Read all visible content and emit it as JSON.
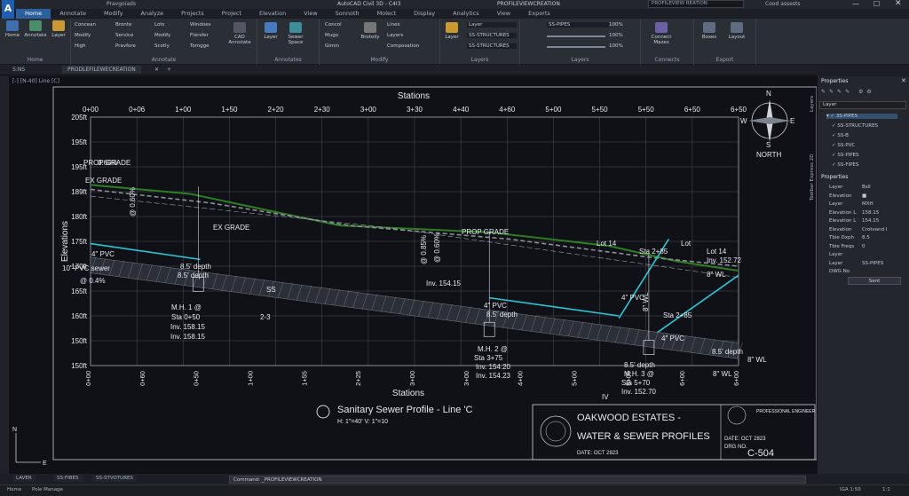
{
  "app": {
    "quick_access": "Pravgoiads",
    "title": "AutoCAD Civil 3D - C4I3",
    "title_sub": "PROFILEVIEWCREATION",
    "search_placeholder": "PROFILEVIEW REATION",
    "user": "Cood assests"
  },
  "ribbon_tabs": [
    "Home",
    "Annotate",
    "Modify",
    "Analyze",
    "Projects",
    "Project",
    "Elevation",
    "View",
    "Sonnoth",
    "Molect",
    "Display",
    "Analytics",
    "View",
    "Exports"
  ],
  "ribbon": {
    "home_btn": "Home",
    "annotate_btn": "Annotate",
    "layer_btn": "Layer",
    "panel_home": "Home",
    "group1": [
      "Concean",
      "Modify",
      "High"
    ],
    "group2": [
      "Bronte",
      "Service",
      "Pravfore"
    ],
    "group3": [
      "Lots",
      "Modify",
      "Scotly"
    ],
    "group4": [
      "Windoes",
      "Flersfer",
      "Tomgge"
    ],
    "cad_annotate": "CAD Annotate",
    "panel_annotate": "Annotate",
    "layer2": "Layer",
    "sewer_space": "Sewer Space",
    "group5": [
      "Concol",
      "Mugo",
      "Gimin"
    ],
    "brotoily": "Brotoily",
    "group6": [
      "Lines",
      "Layers",
      "Composation"
    ],
    "panel_annotates": "Annotates",
    "panel_modify": "Modify",
    "layer3": "Layer",
    "layer_rows": [
      "SS-STRUCTURES",
      "SS-STRUCTURES"
    ],
    "layer_sel": "Layer",
    "panel_layers": "Layers",
    "pipes_row": "SS-PIPES",
    "vals": [
      "100%",
      "100%",
      "100%"
    ],
    "panel_layers2": "Layers",
    "connect": "Connect Mazes",
    "panel_connects": "Connects",
    "boxes": "Boxes",
    "layout": "Layout",
    "panel_export": "Export"
  },
  "doc_tabs": [
    "S:NS",
    "PRODLEFILEWECREATION"
  ],
  "view_label": "[-] [N-40] Line [C]",
  "chart_data": {
    "type": "line",
    "title": "Sanitary Sewer Profile - Line 'C",
    "subtitle": "H: 1\"=40'  V: 1\"=10",
    "x_title_top": "Stations",
    "x_title_bottom": "Stations",
    "ylabel": "Elevations",
    "x_top_ticks": [
      "0+00",
      "0+06",
      "1+00",
      "1+50",
      "2+20",
      "2+30",
      "3+00",
      "3+30",
      "4+40",
      "4+60",
      "5+00",
      "5+50",
      "5+50",
      "6+50",
      "6+50"
    ],
    "x_bottom_ticks": [
      "0+00",
      "0+60",
      "0+50",
      "1+00",
      "1+55",
      "2+25",
      "3+00",
      "3+00",
      "4+00",
      "5+00",
      "5+00",
      "6+00",
      "6+00"
    ],
    "y_ticks": [
      "205ft",
      "195ft",
      "195ft",
      "189ft",
      "180ft",
      "175ft",
      "170ft",
      "165ft",
      "160ft",
      "150ft",
      "150ft"
    ],
    "xlim": [
      0,
      650
    ],
    "ylim": [
      150,
      205
    ],
    "grid": true,
    "series": [
      {
        "name": "PROP GRADE",
        "color": "#2d7d22",
        "x": [
          0,
          100,
          250,
          400,
          520,
          590,
          650
        ],
        "y": [
          190,
          188,
          181,
          179.5,
          176.5,
          173,
          171
        ]
      },
      {
        "name": "EX GRADE",
        "color": "#8a8f97",
        "x": [
          0,
          120,
          260,
          420,
          560,
          650
        ],
        "y": [
          189,
          186,
          181,
          178,
          174,
          172
        ]
      },
      {
        "name": "",
        "color": "#2233ff",
        "x": [
          0,
          650
        ],
        "y": [
          172,
          153
        ]
      },
      {
        "name": "",
        "color": "#25c7d8",
        "x": [
          0,
          110
        ],
        "y": [
          177,
          173.5
        ]
      },
      {
        "name": "",
        "color": "#25c7d8",
        "x": [
          400,
          530
        ],
        "y": [
          165,
          161
        ]
      },
      {
        "name": "",
        "color": "#25c7d8",
        "x": [
          530,
          560,
          650
        ],
        "y": [
          158,
          156,
          170
        ]
      },
      {
        "name": "",
        "color": "#25c7d8",
        "x": [
          530,
          580
        ],
        "y": [
          160.5,
          178
        ]
      }
    ],
    "annotations": [
      "PROP GRADE",
      "EX GRADE",
      "EX GRADE",
      "PROP GRADE",
      "4\" PVC",
      "10\" PVC sewer",
      "@ 0.4%",
      "8.5' depth",
      "8.5' depth",
      "SS",
      "2-3",
      "M.H. 1 @",
      "Sta 0+50",
      "Inv. 158.15",
      "Inv. 158.15",
      "@ 0.60%",
      "@ 0.60%",
      "@ 0.85%",
      "Inv. 154.15",
      "4\" PVC",
      "8.5' depth",
      "M.H. 2 @",
      "Sta 3+75",
      "Inv. 154.20",
      "Inv. 154.23",
      "4\" PVC",
      "Lot 14",
      "Sta 2+85",
      "Lot",
      "Lot 14",
      "Sta 2+85",
      "4\" PVC",
      "8.5' depth",
      "M.H. 3 @",
      "Sta 5+70",
      "Inv. 152.70",
      "Inv. 152.72",
      "8\" WL",
      "8.5' depth",
      "8\" WL",
      "8\" WL",
      "IV",
      "8\" WL",
      "0.60%"
    ]
  },
  "compass": {
    "n": "N",
    "s": "S",
    "e": "E",
    "w": "W",
    "label": "NORTH"
  },
  "ucs": {
    "n": "N",
    "e": "E"
  },
  "titleblock": {
    "line1": "OAKWOOD ESTATES -",
    "line2": "WATER & SEWER PROFILES",
    "date_left": "DATE: OCT 2823",
    "stamp_text": "PROFESSIONAL ENGINEER STATE OF",
    "date_right": "DATE: OCT 2823",
    "dwg_no_label": "DRG NO.",
    "sheet": "C-504"
  },
  "properties": {
    "title": "Properties",
    "layer_dropdown": "Layer",
    "tree": [
      "3S-PIPES",
      "SS-STRUCTURES",
      "SS-B",
      "SS-PVC",
      "SS-PIPES",
      "SS-FIPES"
    ],
    "section": "Properties",
    "rows": [
      {
        "k": "Layer",
        "v": "Bsll"
      },
      {
        "k": "Elevation",
        "v": "■"
      },
      {
        "k": "Layer",
        "v": "MXH"
      },
      {
        "k": "Elevation L",
        "v": "158.15"
      },
      {
        "k": "Elevation L",
        "v": "154.15"
      },
      {
        "k": "Elevation",
        "v": "Crotvand I"
      },
      {
        "k": "Tbie Dxph",
        "v": "8.5"
      },
      {
        "k": "Tbie Freqs",
        "v": "0"
      },
      {
        "k": "Layer",
        "v": ""
      },
      {
        "k": "Layer",
        "v": "SS-PIPES"
      },
      {
        "k": "DWG No",
        "v": ""
      }
    ],
    "sent_btn": "Sent",
    "side_tab1": "Layers",
    "side_tab2": "Toolbar Express 2D"
  },
  "layout_tabs": [
    "LAVER",
    "SS-FIBES",
    "SS-STVOTURES"
  ],
  "bottom_tabs": [
    "Home",
    "Pole Manage"
  ],
  "command": {
    "label": "Command:",
    "value": "_PROFILEVIEWCREATION"
  },
  "status": {
    "right": "IGA 1:50",
    "zoom": "1:1"
  }
}
